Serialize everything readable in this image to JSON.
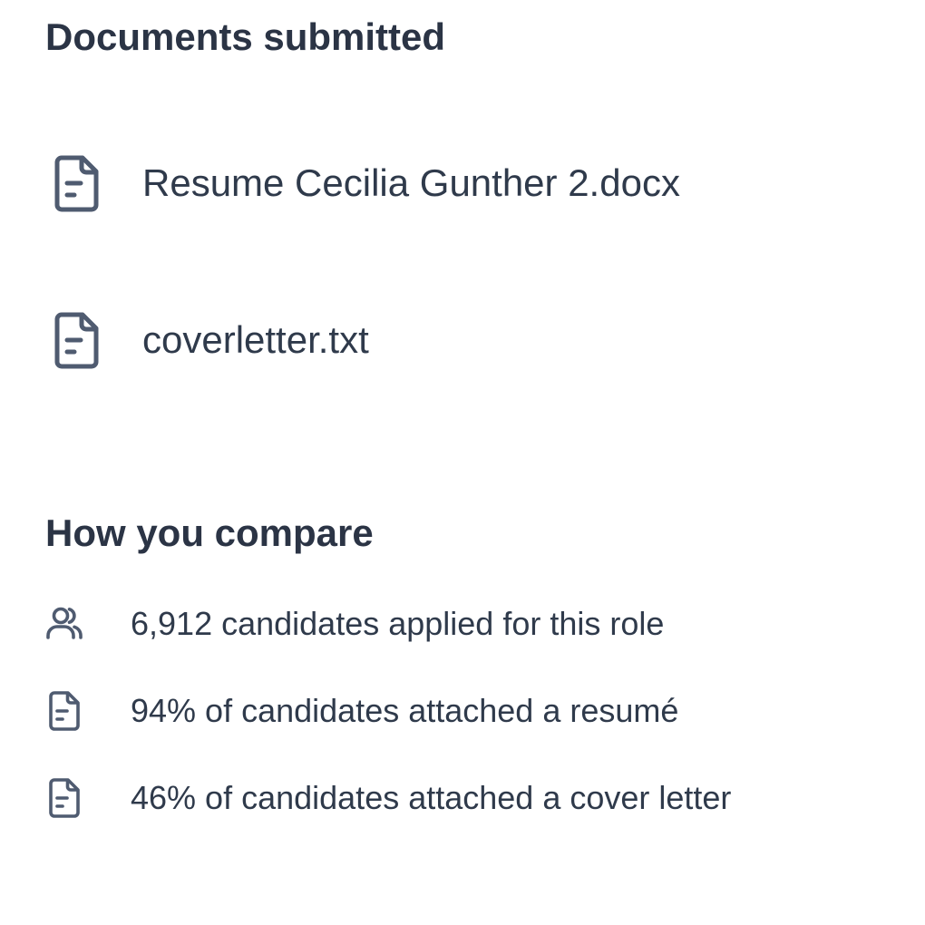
{
  "documents_section": {
    "title": "Documents submitted",
    "documents": [
      {
        "name": "Resume Cecilia Gunther 2.docx",
        "icon": "file-text-icon"
      },
      {
        "name": "coverletter.txt",
        "icon": "file-text-icon"
      }
    ]
  },
  "compare_section": {
    "title": "How you compare",
    "stats": [
      {
        "text": "6,912 candidates applied for this role",
        "icon": "users-icon"
      },
      {
        "text": "94% of candidates attached a resumé",
        "icon": "file-text-icon"
      },
      {
        "text": "46% of candidates attached a cover letter",
        "icon": "file-text-icon"
      }
    ]
  },
  "colors": {
    "text": "#2f3a4b",
    "icon": "#4f5b70",
    "background": "#ffffff"
  }
}
